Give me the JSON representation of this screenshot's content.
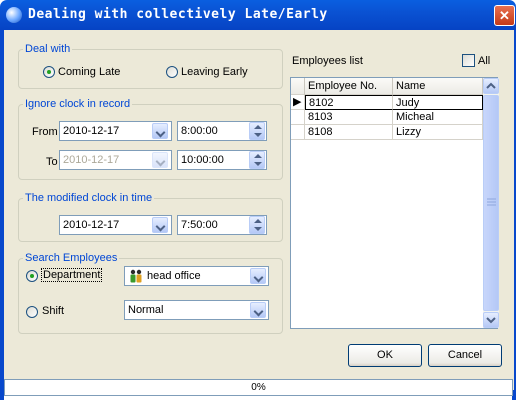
{
  "window": {
    "title": "Dealing with collectively Late/Early",
    "close_icon": "close-icon"
  },
  "deal_with": {
    "legend": "Deal with",
    "options": [
      {
        "label": "Coming Late",
        "selected": true
      },
      {
        "label": "Leaving Early",
        "selected": false
      }
    ]
  },
  "ignore_clock": {
    "legend": "Ignore clock in record",
    "from_label": "From",
    "from_date": "2010-12-17",
    "from_time": "8:00:00",
    "to_label": "To",
    "to_date": "2010-12-17",
    "to_time": "10:00:00"
  },
  "modified_clock": {
    "legend": "The modified clock in time",
    "date": "2010-12-17",
    "time": "7:50:00"
  },
  "search": {
    "legend": "Search Employees",
    "department_label": "Department",
    "department_selected": true,
    "department_value": "head office",
    "shift_label": "Shift",
    "shift_selected": false,
    "shift_value": "Normal"
  },
  "employees": {
    "label": "Employees list",
    "all_label": "All",
    "all_checked": false,
    "columns": [
      "Employee No.",
      "Name"
    ],
    "rows": [
      {
        "no": "8102",
        "name": "Judy",
        "current": true
      },
      {
        "no": "8103",
        "name": "Micheal",
        "current": false
      },
      {
        "no": "8108",
        "name": "Lizzy",
        "current": false
      }
    ]
  },
  "buttons": {
    "ok": "OK",
    "cancel": "Cancel"
  },
  "progress": {
    "text": "0%",
    "value": 0
  },
  "colors": {
    "titlebar": "#0a52d3",
    "legend": "#0046d5",
    "face": "#ece9d8"
  }
}
